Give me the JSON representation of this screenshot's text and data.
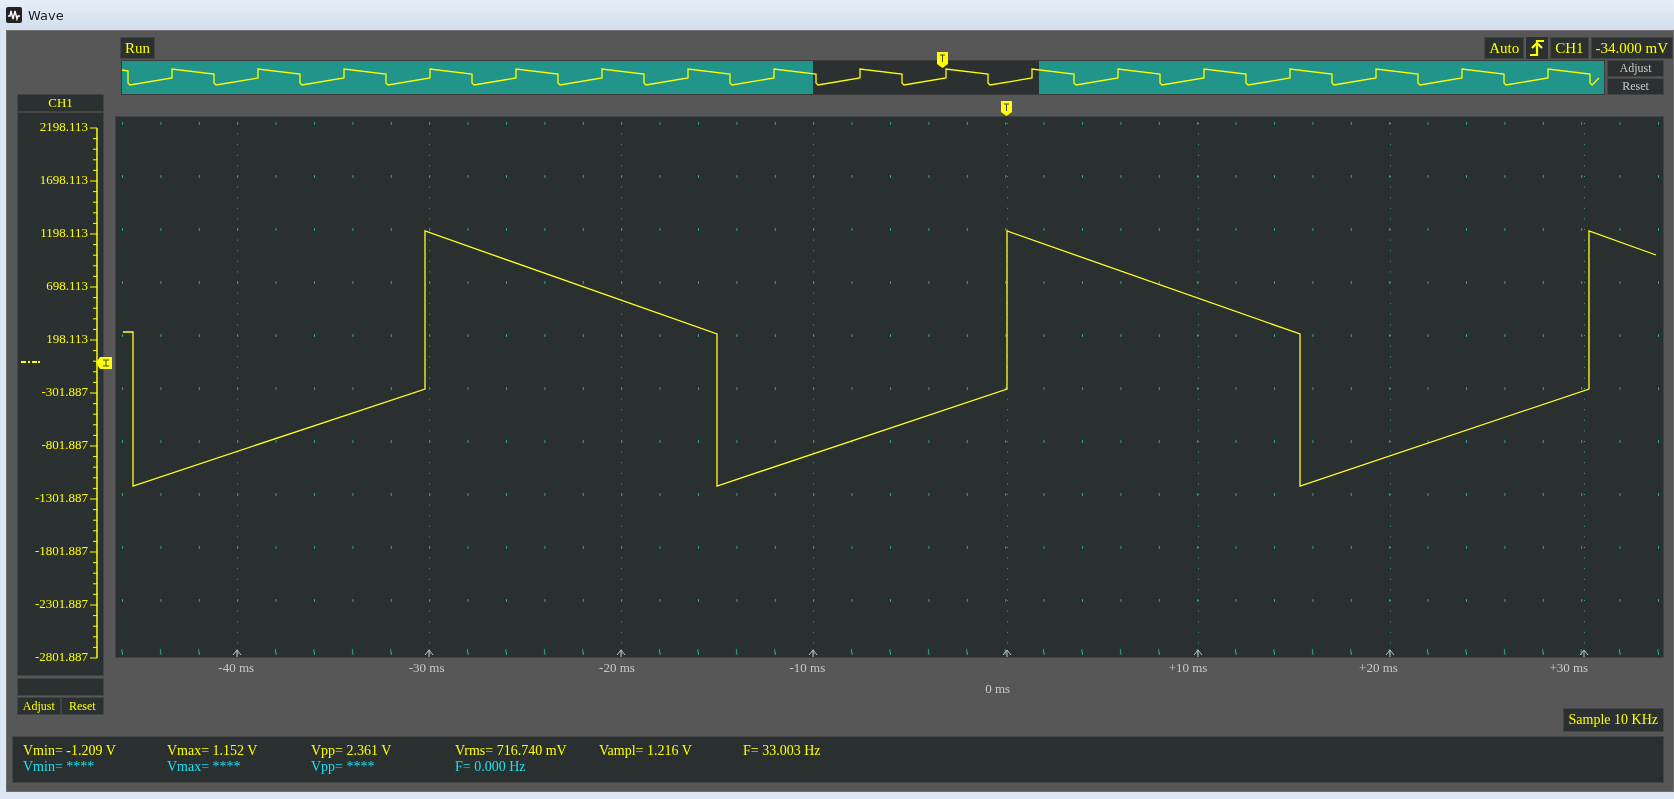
{
  "window": {
    "title": "Wave"
  },
  "toolbar": {
    "run_button": "Run",
    "trigger_mode": "Auto",
    "trigger_channel": "CH1",
    "trigger_level": "-34.000 mV"
  },
  "overview": {
    "buttons": [
      "Adjust",
      "Reset"
    ]
  },
  "channel_panel": {
    "title": "CH1",
    "scale_labels": [
      "2198.113",
      "1698.113",
      "1198.113",
      "698.113",
      "198.113",
      "-301.887",
      "-801.887",
      "-1301.887",
      "-1801.887",
      "-2301.887",
      "-2801.887"
    ],
    "buttons": [
      "Adjust",
      "Reset"
    ]
  },
  "time_labels": [
    {
      "text": "-40 ms",
      "kind": "tick"
    },
    {
      "text": "-30 ms",
      "kind": "tick"
    },
    {
      "text": "-20 ms",
      "kind": "tick"
    },
    {
      "text": "-10 ms",
      "kind": "tick"
    },
    {
      "text": "0 ms",
      "kind": "origin"
    },
    {
      "text": "+10 ms",
      "kind": "tick"
    },
    {
      "text": "+20 ms",
      "kind": "tick"
    },
    {
      "text": "+30 ms",
      "kind": "tick"
    }
  ],
  "sample_rate": "Sample 10 KHz",
  "measurements": [
    {
      "kind": "primary",
      "items": [
        "Vmin= -1.209 V",
        "Vmax= 1.152 V",
        "Vpp= 2.361 V",
        "Vrms= 716.740 mV",
        "Vampl= 1.216 V",
        "F= 33.003 Hz"
      ]
    },
    {
      "kind": "secondary",
      "items": [
        "Vmin= ****",
        "Vmax= ****",
        "Vpp= ****",
        "F= 0.000 Hz"
      ]
    }
  ]
}
